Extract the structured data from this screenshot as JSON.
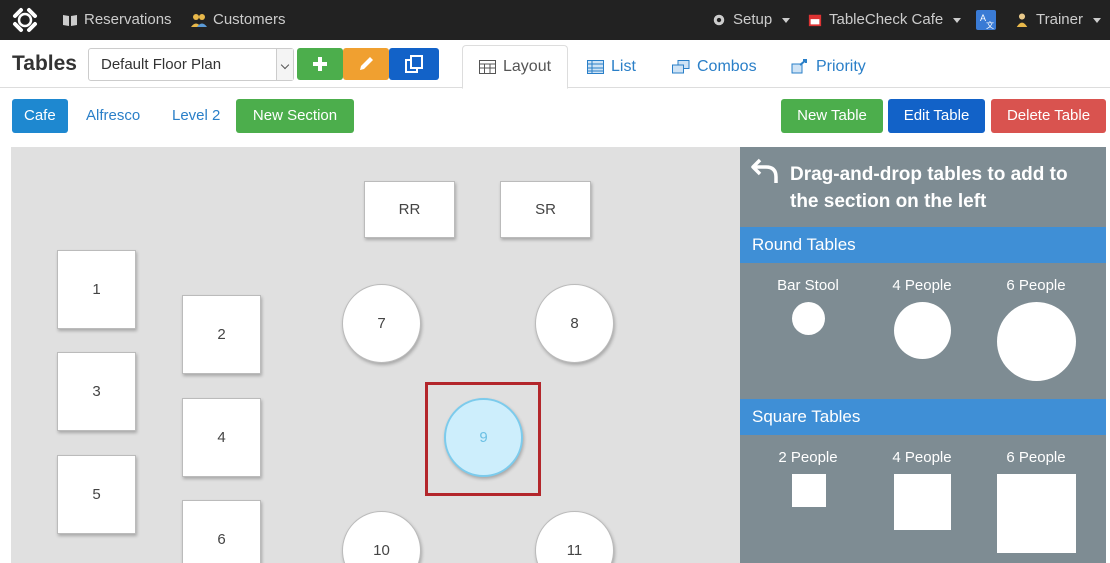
{
  "topbar": {
    "reservations": "Reservations",
    "customers": "Customers",
    "setup": "Setup",
    "venue": "TableCheck Cafe",
    "user": "Trainer"
  },
  "header": {
    "title": "Tables",
    "floor_plan": "Default Floor Plan",
    "tabs": [
      "Layout",
      "List",
      "Combos",
      "Priority"
    ]
  },
  "sections": [
    "Cafe",
    "Alfresco",
    "Level 2"
  ],
  "actions": {
    "new_section": "New Section",
    "new_table": "New Table",
    "edit_table": "Edit Table",
    "delete_table": "Delete Table"
  },
  "floor_tables": [
    "RR",
    "SR",
    "1",
    "2",
    "3",
    "4",
    "5",
    "6",
    "7",
    "8",
    "9",
    "10",
    "11"
  ],
  "selected_table": "9",
  "palette": {
    "instruction": "Drag-and-drop tables to add to the section on the left",
    "round_title": "Round Tables",
    "round_items": [
      "Bar Stool",
      "4 People",
      "6 People"
    ],
    "square_title": "Square Tables",
    "square_items": [
      "2 People",
      "4 People",
      "6 People"
    ]
  },
  "colors": {
    "navbar": "#222222",
    "accent_blue": "#1e88d0",
    "green": "#4cae4c",
    "red": "#d9534f",
    "palette_bg": "#7e8c93",
    "selection_outline": "#b3262b"
  }
}
